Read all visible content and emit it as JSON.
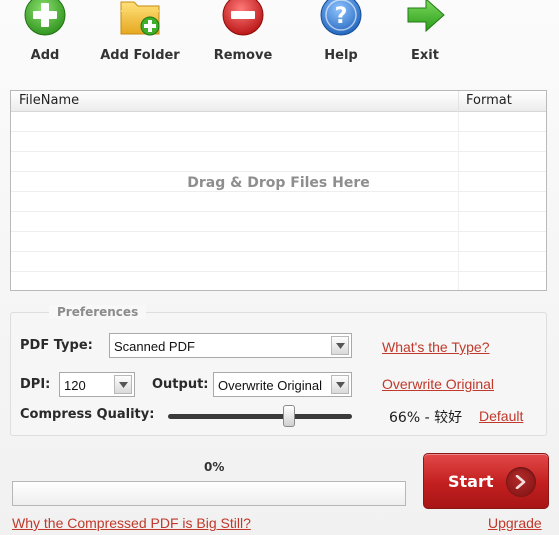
{
  "toolbar": {
    "add": "Add",
    "add_folder": "Add Folder",
    "remove": "Remove",
    "help": "Help",
    "exit": "Exit"
  },
  "file_list": {
    "columns": [
      "FileName",
      "Format"
    ],
    "drop_hint": "Drag & Drop Files Here"
  },
  "preferences": {
    "legend": "Preferences",
    "pdf_type_label": "PDF Type:",
    "pdf_type_value": "Scanned PDF",
    "whats_type_link": "What's the Type?",
    "dpi_label": "DPI:",
    "dpi_value": "120",
    "output_label": "Output:",
    "output_value": "Overwrite Original",
    "output_link": "Overwrite Original",
    "compress_label": "Compress Quality:",
    "quality_value": 0.66,
    "quality_text": "66% - 较好",
    "default_link": "Default"
  },
  "progress": {
    "label": "0%",
    "value": 0
  },
  "start_label": "Start",
  "footer": {
    "why_link": "Why the Compressed PDF is Big Still?",
    "upgrade_link": "Upgrade"
  },
  "colors": {
    "link": "#c0392b",
    "start": "#c62828",
    "add_green": "#3fae2a",
    "remove_red": "#d81e1e",
    "help_blue": "#2d7fd8",
    "folder_yellow": "#f3c233"
  },
  "icons": {
    "add": "plus-circle-icon",
    "add_folder": "folder-plus-icon",
    "remove": "minus-circle-icon",
    "help": "question-circle-icon",
    "exit": "arrow-right-icon",
    "start": "chevron-right-icon"
  }
}
